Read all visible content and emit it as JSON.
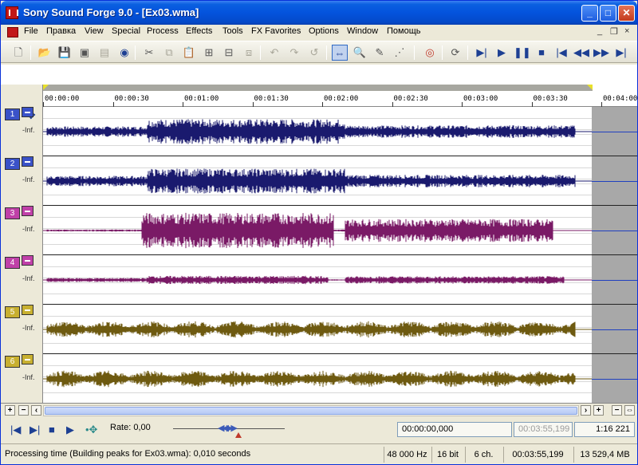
{
  "window": {
    "title": "Sony Sound Forge 9.0 - [Ex03.wma]",
    "minimize_icon": "minimize-icon",
    "maximize_icon": "maximize-icon",
    "close_icon": "close-icon"
  },
  "menu": {
    "items": [
      "File",
      "Правка",
      "View",
      "Special",
      "Process",
      "Effects",
      "Tools",
      "FX Favorites",
      "Options",
      "Window",
      "Помощь"
    ],
    "mdi_controls": [
      "_",
      "❐",
      "×"
    ]
  },
  "toolbar": {
    "icons": [
      "new-file-icon",
      "open-folder-icon",
      "save-icon",
      "save-all-icon",
      "save-as-icon",
      "render-icon",
      "cut-icon",
      "copy-icon",
      "paste-icon",
      "paste-mix-icon",
      "paste-crossfade-icon",
      "trim-crop-icon",
      "undo-icon",
      "redo-icon",
      "repeat-icon",
      "edit-tool-icon",
      "magnify-tool-icon",
      "pencil-tool-icon",
      "envelope-tool-icon",
      "record-icon",
      "loop-icon",
      "play-all-icon",
      "play-icon",
      "pause-icon",
      "stop-icon",
      "go-to-start-icon",
      "rewind-icon",
      "forward-icon",
      "go-to-end-icon"
    ]
  },
  "timeline": {
    "ticks": [
      "00:00:00",
      "00:00:30",
      "00:01:00",
      "00:01:30",
      "00:02:00",
      "00:02:30",
      "00:03:00",
      "00:03:30",
      "00:04:00"
    ]
  },
  "channels": [
    {
      "num": "1",
      "level": "-Inf.",
      "color": "#1a1a6e",
      "btn_color": "#3a52c8"
    },
    {
      "num": "2",
      "level": "-Inf.",
      "color": "#1a1a6e",
      "btn_color": "#3a52c8"
    },
    {
      "num": "3",
      "level": "-Inf.",
      "color": "#7a1a66",
      "btn_color": "#c040a8"
    },
    {
      "num": "4",
      "level": "-Inf.",
      "color": "#7a1a66",
      "btn_color": "#c040a8"
    },
    {
      "num": "5",
      "level": "-Inf.",
      "color": "#6e5a10",
      "btn_color": "#c8b030"
    },
    {
      "num": "6",
      "level": "-Inf.",
      "color": "#6e5a10",
      "btn_color": "#c8b030"
    }
  ],
  "transport": {
    "rate_label": "Rate: 0,00",
    "cursor_time": "00:00:00,000",
    "selection_time": "00:03:55,199",
    "zoom_ratio": "1:16 221"
  },
  "status": {
    "message": "Processing time (Building peaks for Ex03.wma): 0,010 seconds",
    "sample_rate": "48 000 Hz",
    "bit_depth": "16 bit",
    "channels": "6 ch.",
    "length": "00:03:55,199",
    "free_space": "13 529,4 MB"
  }
}
